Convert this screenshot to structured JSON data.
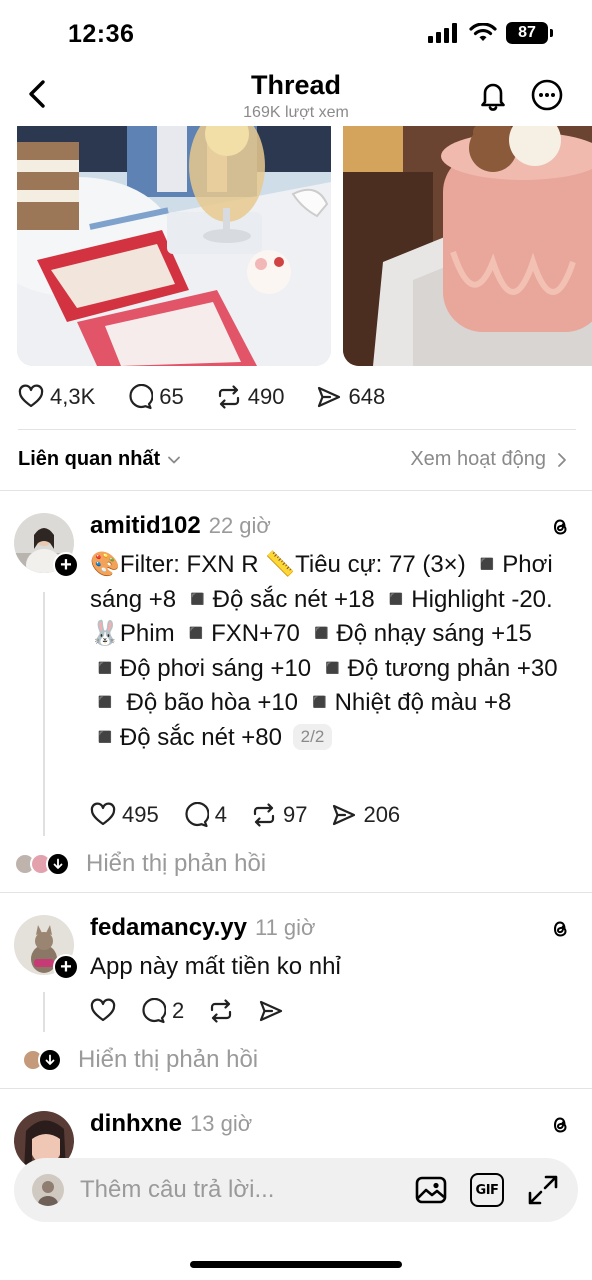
{
  "status": {
    "time": "12:36",
    "battery": "87"
  },
  "nav": {
    "title": "Thread",
    "views": "169K lượt xem"
  },
  "post_actions": {
    "likes": "4,3K",
    "comments": "65",
    "reposts": "490",
    "shares": "648"
  },
  "sort": {
    "label": "Liên quan nhất",
    "activity_link": "Xem hoạt động"
  },
  "replies": [
    {
      "username": "amitid102",
      "time": "22 giờ",
      "text": "🎨Filter: FXN R 📏Tiêu cự: 77 (3×) ◾️Phơi sáng +8 ◾️Độ sắc nét +18 ◾️Highlight -20. 🐰Phim ◾️FXN+70 ◾️Độ nhạy sáng +15 ◾️Độ phơi sáng +10 ◾️Độ tương phản +30 ◾️ Độ bão hòa +10 ◾️Nhiệt độ màu +8 ◾️Độ sắc nét +80",
      "page": "2/2",
      "likes": "495",
      "comments": "4",
      "reposts": "97",
      "shares": "206",
      "show_replies": "Hiển thị phản hồi"
    },
    {
      "username": "fedamancy.yy",
      "time": "11 giờ",
      "text": "App này mất tiền ko nhỉ",
      "likes": "",
      "comments": "2",
      "reposts": "",
      "shares": "",
      "show_replies": "Hiển thị phản hồi"
    },
    {
      "username": "dinhxne",
      "time": "13 giờ"
    }
  ],
  "composer": {
    "placeholder": "Thêm câu trả lời...",
    "gif": "GIF"
  },
  "icons": [
    "chevron-left-icon",
    "bell-icon",
    "more-icon",
    "heart-icon",
    "comment-icon",
    "repost-icon",
    "share-icon",
    "threads-logo-icon",
    "image-icon",
    "expand-icon"
  ]
}
